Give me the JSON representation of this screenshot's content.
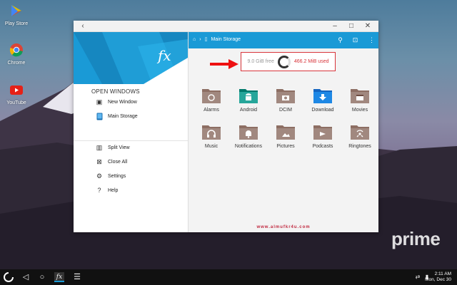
{
  "desktop": {
    "icons": [
      {
        "label": "Play Store"
      },
      {
        "label": "Chrome"
      },
      {
        "label": "YouTube"
      }
    ],
    "watermark": "prime"
  },
  "window": {
    "drawer": {
      "section_title": "OPEN WINDOWS",
      "windows": [
        {
          "label": "New Window",
          "icon": "new-window-icon"
        },
        {
          "label": "Main Storage",
          "icon": "phone-storage-icon"
        }
      ],
      "actions": [
        {
          "label": "Split View",
          "icon": "split-view-icon"
        },
        {
          "label": "Close All",
          "icon": "close-all-icon"
        },
        {
          "label": "Settings",
          "icon": "gear-icon"
        },
        {
          "label": "Help",
          "icon": "help-icon"
        }
      ]
    },
    "toolbar": {
      "breadcrumb": "Main Storage"
    },
    "storage": {
      "free": "9.0 GiB free",
      "used": "466.2 MiB used"
    },
    "folders": [
      {
        "label": "Alarms",
        "icon": "alarm-icon",
        "color": "#8d6e63"
      },
      {
        "label": "Android",
        "icon": "android-icon",
        "color": "#26a69a"
      },
      {
        "label": "DCIM",
        "icon": "camera-icon",
        "color": "#8d6e63"
      },
      {
        "label": "Download",
        "icon": "download-icon",
        "color": "#1e88e5"
      },
      {
        "label": "Movies",
        "icon": "film-icon",
        "color": "#8d6e63"
      },
      {
        "label": "Music",
        "icon": "headphones-icon",
        "color": "#8d6e63"
      },
      {
        "label": "Notifications",
        "icon": "bell-icon",
        "color": "#8d6e63"
      },
      {
        "label": "Pictures",
        "icon": "image-icon",
        "color": "#8d6e63"
      },
      {
        "label": "Podcasts",
        "icon": "podcast-icon",
        "color": "#8d6e63"
      },
      {
        "label": "Ringtones",
        "icon": "ringtone-icon",
        "color": "#8d6e63"
      }
    ],
    "site_watermark": "www.almufkr4u.com"
  },
  "taskbar": {
    "time": "2:11 AM",
    "date": "Mon, Dec 30"
  },
  "colors": {
    "accent": "#1a9ad6",
    "highlight": "#d8343a"
  }
}
